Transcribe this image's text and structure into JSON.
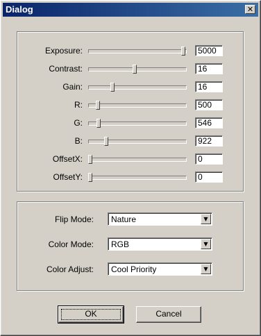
{
  "window": {
    "title": "Dialog"
  },
  "sliders": [
    {
      "label": "Exposure:",
      "value": "5000",
      "level": 1.0
    },
    {
      "label": "Contrast:",
      "value": "16",
      "level": 0.48
    },
    {
      "label": "Gain:",
      "value": "16",
      "level": 0.24
    },
    {
      "label": "R:",
      "value": "500",
      "level": 0.08
    },
    {
      "label": "G:",
      "value": "546",
      "level": 0.09
    },
    {
      "label": "B:",
      "value": "922",
      "level": 0.17
    },
    {
      "label": "OffsetX:",
      "value": "0",
      "level": 0.0
    },
    {
      "label": "OffsetY:",
      "value": "0",
      "level": 0.0
    }
  ],
  "combos": [
    {
      "label": "Flip Mode:",
      "value": "Nature"
    },
    {
      "label": "Color Mode:",
      "value": "RGB"
    },
    {
      "label": "Color Adjust:",
      "value": "Cool Priority"
    }
  ],
  "buttons": {
    "ok": "OK",
    "cancel": "Cancel"
  }
}
